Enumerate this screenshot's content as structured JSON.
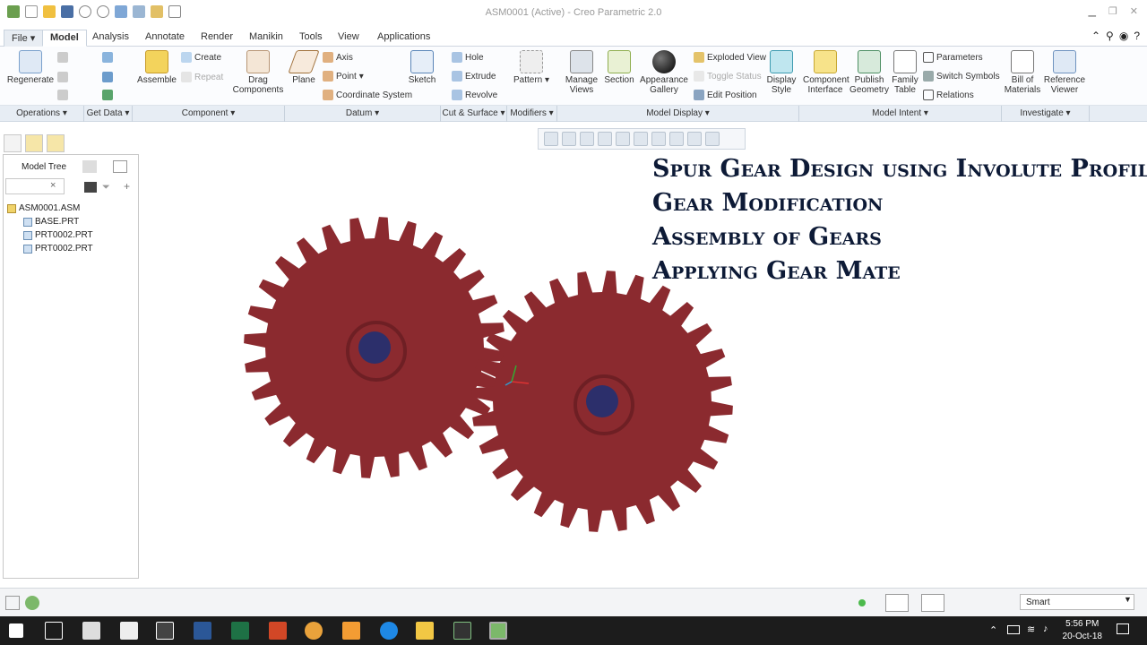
{
  "app": {
    "title": "ASM0001 (Active) - Creo Parametric 2.0"
  },
  "tabs": [
    {
      "label": "File ▾"
    },
    {
      "label": "Model"
    },
    {
      "label": "Analysis"
    },
    {
      "label": "Annotate"
    },
    {
      "label": "Render"
    },
    {
      "label": "Manikin"
    },
    {
      "label": "Tools"
    },
    {
      "label": "View"
    },
    {
      "label": "Applications"
    }
  ],
  "ribbon": {
    "regenerate": "Regenerate",
    "assemble": "Assemble",
    "create": "Create",
    "repeat": "Repeat",
    "drag": "Drag Components",
    "plane": "Plane",
    "axis": "Axis",
    "point": "Point",
    "coord": "Coordinate System",
    "sketch": "Sketch",
    "hole": "Hole",
    "extrude": "Extrude",
    "revolve": "Revolve",
    "pattern": "Pattern",
    "manage_views": "Manage Views",
    "section": "Section",
    "appearance": "Appearance Gallery",
    "exploded": "Exploded View",
    "toggle": "Toggle Status",
    "edit_position": "Edit Position",
    "display_style": "Display Style",
    "component_interface": "Component Interface",
    "publish": "Publish Geometry",
    "family": "Family Table",
    "parameters": "Parameters",
    "switch_symbols": "Switch Symbols",
    "relations": "Relations",
    "bom": "Bill of Materials",
    "reference_viewer": "Reference Viewer"
  },
  "groups": [
    {
      "label": "Operations ▾"
    },
    {
      "label": "Get Data ▾"
    },
    {
      "label": "Component ▾"
    },
    {
      "label": "Datum ▾"
    },
    {
      "label": "Cut & Surface ▾"
    },
    {
      "label": "Modifiers ▾"
    },
    {
      "label": "Model Display ▾"
    },
    {
      "label": "Model Intent ▾"
    },
    {
      "label": "Investigate ▾"
    }
  ],
  "model_tree": {
    "label": "Model Tree",
    "items": [
      "ASM0001.ASM",
      "BASE.PRT",
      "PRT0002.PRT",
      "PRT0002.PRT"
    ]
  },
  "overlay": {
    "lines": [
      "Spur Gear Design using Involute Profile",
      "Gear Modification",
      "Assembly of Gears",
      "Applying Gear Mate"
    ]
  },
  "status": {
    "filter": "Smart"
  },
  "taskbar": {
    "time": "5:56 PM",
    "date": "20-Oct-18"
  },
  "colors": {
    "gear": "#8b2a2f",
    "hub": "#2c2f6b",
    "accent": "#1e5aa8"
  }
}
